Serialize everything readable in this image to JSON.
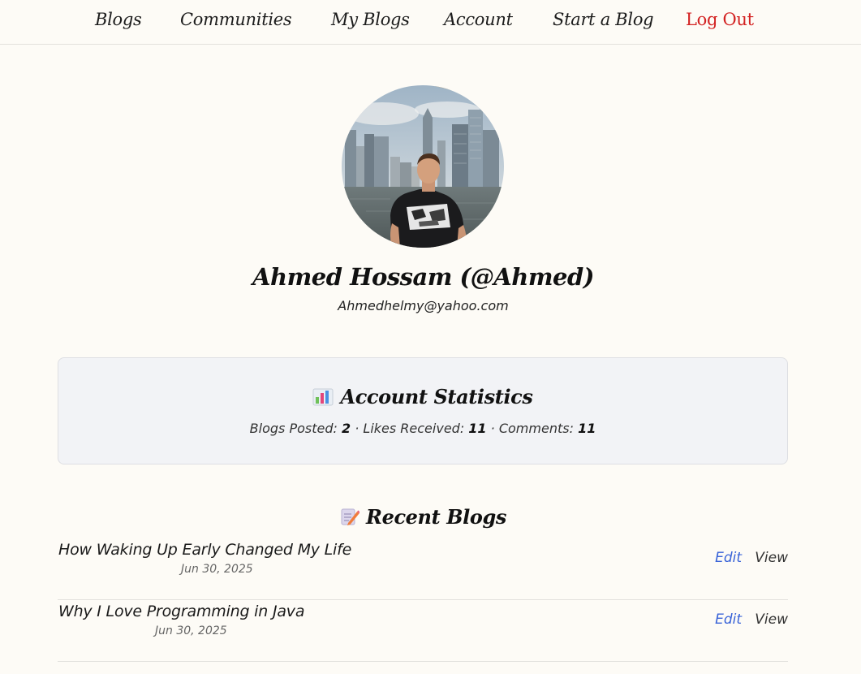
{
  "nav": {
    "blogs": "Blogs",
    "communities": "Communities",
    "my_blogs": "My Blogs",
    "account": "Account",
    "start_blog": "Start a Blog",
    "logout": "Log Out"
  },
  "profile": {
    "name": "Ahmed Hossam (@Ahmed)",
    "email": "Ahmedhelmy@yahoo.com",
    "avatar_icon": "profile-photo"
  },
  "stats": {
    "icon": "bar-chart-icon",
    "title": "Account Statistics",
    "blogs_label": "Blogs Posted:",
    "blogs_value": "2",
    "likes_label": "Likes Received:",
    "likes_value": "11",
    "comments_label": "Comments:",
    "comments_value": "11",
    "separator": "·"
  },
  "recent": {
    "icon": "memo-icon",
    "title": "Recent Blogs",
    "items": [
      {
        "title": "How Waking Up Early Changed My Life",
        "date": "Jun 30, 2025",
        "edit": "Edit",
        "view": "View"
      },
      {
        "title": "Why I Love Programming in Java",
        "date": "Jun 30, 2025",
        "edit": "Edit",
        "view": "View"
      }
    ]
  },
  "colors": {
    "background": "#fdfbf6",
    "logout": "#d32222",
    "edit_link": "#3a64d8",
    "card_bg": "#f2f3f6"
  }
}
